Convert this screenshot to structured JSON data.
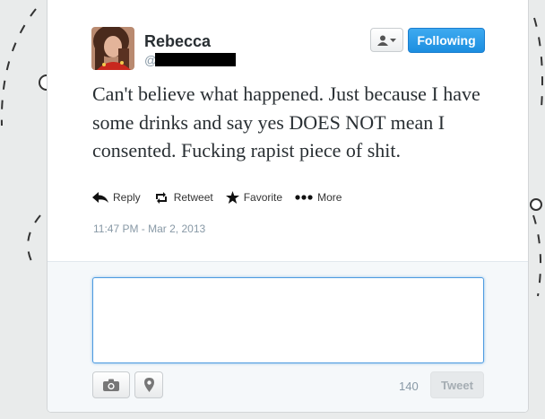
{
  "user": {
    "display_name": "Rebecca",
    "handle_prefix": "@"
  },
  "header": {
    "follow_menu_icon": "person-icon",
    "following_label": "Following",
    "accent_color": "#2b99e8"
  },
  "tweet": {
    "text": "Can't believe what happened. Just because I have some drinks and say yes DOES NOT mean I consented. Fucking rapist piece of shit.",
    "timestamp": "11:47 PM - Mar 2, 2013"
  },
  "actions": {
    "reply": "Reply",
    "retweet": "Retweet",
    "favorite": "Favorite",
    "more": "More"
  },
  "composer": {
    "reply_value": "",
    "char_count": "140",
    "tweet_button": "Tweet",
    "icons": [
      "camera-icon",
      "location-pin-icon"
    ]
  }
}
